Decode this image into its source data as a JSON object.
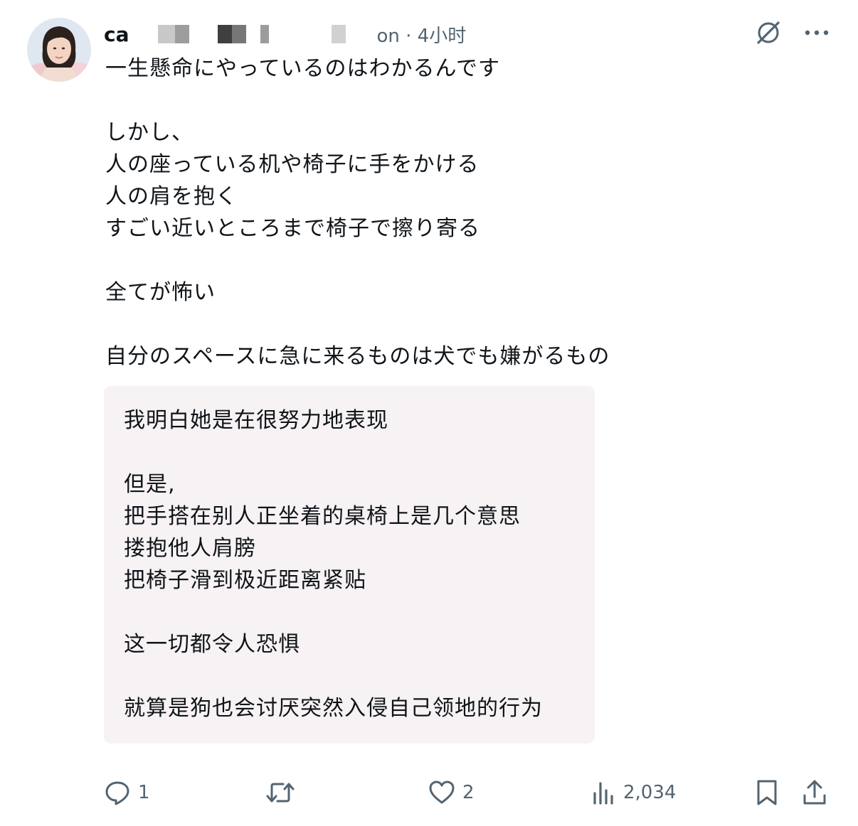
{
  "post": {
    "author_name": "ca",
    "meta": "on · 4小时",
    "text": "一生懸命にやっているのはわかるんです\n\nしかし、\n人の座っている机や椅子に手をかける\n人の肩を抱く\nすごい近いところまで椅子で擦り寄る\n\n全てが怖い\n\n自分のスペースに急に来るものは犬でも嫌がるもの",
    "translation": "我明白她是在很努力地表现\n\n但是,\n把手搭在别人正坐着的桌椅上是几个意思\n搂抱他人肩膀\n把椅子滑到极近距离紧贴\n\n这一切都令人恐惧\n\n就算是狗也会讨厌突然入侵自己领地的行为"
  },
  "actions": {
    "reply_count": "1",
    "retweet_count": "",
    "like_count": "2",
    "views_count": "2,034"
  },
  "icons": {
    "header": [
      "grok-icon",
      "more-icon"
    ],
    "footer": [
      "reply-icon",
      "retweet-icon",
      "like-icon",
      "views-icon",
      "bookmark-icon",
      "share-icon"
    ]
  },
  "colors": {
    "text": "#0f1419",
    "secondary": "#536471",
    "translation_bg": "#f7f2f3"
  }
}
